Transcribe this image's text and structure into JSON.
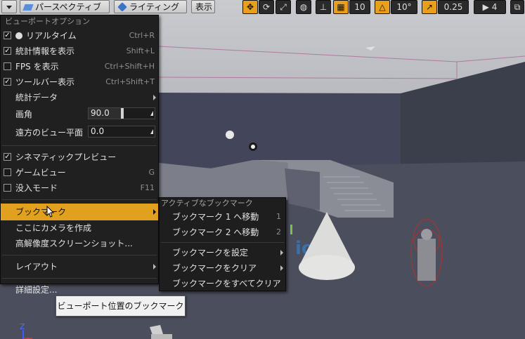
{
  "toolbar": {
    "perspective_label": "パースペクティブ",
    "lighting_label": "ライティング",
    "show_label": "表示",
    "grid_snap_value": "10",
    "rotation_snap_value": "10°",
    "scale_snap_value": "0.25",
    "camera_speed_value": "4"
  },
  "menu": {
    "header": "ビューポートオプション",
    "items": {
      "realtime": {
        "label": "リアルタイム",
        "shortcut": "Ctrl+R",
        "checked": true
      },
      "stats": {
        "label": "統計情報を表示",
        "shortcut": "Shift+L",
        "checked": true
      },
      "fps": {
        "label": "FPS を表示",
        "shortcut": "Ctrl+Shift+H",
        "checked": false
      },
      "toolbar": {
        "label": "ツールバー表示",
        "shortcut": "Ctrl+Shift+T",
        "checked": true
      },
      "stat_data": {
        "label": "統計データ"
      },
      "fov": {
        "label": "画角",
        "value": "90.0"
      },
      "far_plane": {
        "label": "遠方のビュー平面",
        "value": "0.0"
      },
      "cinematic": {
        "label": "シネマティックプレビュー",
        "checked": true
      },
      "game_view": {
        "label": "ゲームビュー",
        "shortcut": "G",
        "checked": false
      },
      "immersive": {
        "label": "没入モード",
        "shortcut": "F11",
        "checked": false
      },
      "bookmark": {
        "label": "ブックマーク"
      },
      "create_camera": {
        "label": "ここにカメラを作成"
      },
      "hires_screenshot": {
        "label": "高解像度スクリーンショット..."
      },
      "layout": {
        "label": "レイアウト"
      },
      "advanced": {
        "label": "詳細設定..."
      }
    }
  },
  "submenu": {
    "header": "アクティブなブックマーク",
    "items": [
      {
        "label": "ブックマーク 1 へ移動",
        "shortcut": "1"
      },
      {
        "label": "ブックマーク 2 へ移動",
        "shortcut": "2"
      },
      {
        "label": "ブックマークを設定"
      },
      {
        "label": "ブックマークをクリア"
      },
      {
        "label": "ブックマークをすべてクリア"
      }
    ]
  },
  "tooltip": "ビューポート位置のブックマーク",
  "axis_label": "Z"
}
